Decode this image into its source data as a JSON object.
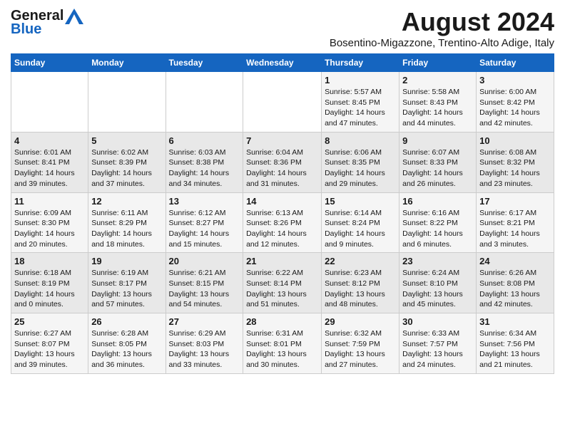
{
  "header": {
    "logo_general": "General",
    "logo_blue": "Blue",
    "month_year": "August 2024",
    "location": "Bosentino-Migazzone, Trentino-Alto Adige, Italy"
  },
  "days_of_week": [
    "Sunday",
    "Monday",
    "Tuesday",
    "Wednesday",
    "Thursday",
    "Friday",
    "Saturday"
  ],
  "weeks": [
    [
      {
        "day": "",
        "info": ""
      },
      {
        "day": "",
        "info": ""
      },
      {
        "day": "",
        "info": ""
      },
      {
        "day": "",
        "info": ""
      },
      {
        "day": "1",
        "info": "Sunrise: 5:57 AM\nSunset: 8:45 PM\nDaylight: 14 hours\nand 47 minutes."
      },
      {
        "day": "2",
        "info": "Sunrise: 5:58 AM\nSunset: 8:43 PM\nDaylight: 14 hours\nand 44 minutes."
      },
      {
        "day": "3",
        "info": "Sunrise: 6:00 AM\nSunset: 8:42 PM\nDaylight: 14 hours\nand 42 minutes."
      }
    ],
    [
      {
        "day": "4",
        "info": "Sunrise: 6:01 AM\nSunset: 8:41 PM\nDaylight: 14 hours\nand 39 minutes."
      },
      {
        "day": "5",
        "info": "Sunrise: 6:02 AM\nSunset: 8:39 PM\nDaylight: 14 hours\nand 37 minutes."
      },
      {
        "day": "6",
        "info": "Sunrise: 6:03 AM\nSunset: 8:38 PM\nDaylight: 14 hours\nand 34 minutes."
      },
      {
        "day": "7",
        "info": "Sunrise: 6:04 AM\nSunset: 8:36 PM\nDaylight: 14 hours\nand 31 minutes."
      },
      {
        "day": "8",
        "info": "Sunrise: 6:06 AM\nSunset: 8:35 PM\nDaylight: 14 hours\nand 29 minutes."
      },
      {
        "day": "9",
        "info": "Sunrise: 6:07 AM\nSunset: 8:33 PM\nDaylight: 14 hours\nand 26 minutes."
      },
      {
        "day": "10",
        "info": "Sunrise: 6:08 AM\nSunset: 8:32 PM\nDaylight: 14 hours\nand 23 minutes."
      }
    ],
    [
      {
        "day": "11",
        "info": "Sunrise: 6:09 AM\nSunset: 8:30 PM\nDaylight: 14 hours\nand 20 minutes."
      },
      {
        "day": "12",
        "info": "Sunrise: 6:11 AM\nSunset: 8:29 PM\nDaylight: 14 hours\nand 18 minutes."
      },
      {
        "day": "13",
        "info": "Sunrise: 6:12 AM\nSunset: 8:27 PM\nDaylight: 14 hours\nand 15 minutes."
      },
      {
        "day": "14",
        "info": "Sunrise: 6:13 AM\nSunset: 8:26 PM\nDaylight: 14 hours\nand 12 minutes."
      },
      {
        "day": "15",
        "info": "Sunrise: 6:14 AM\nSunset: 8:24 PM\nDaylight: 14 hours\nand 9 minutes."
      },
      {
        "day": "16",
        "info": "Sunrise: 6:16 AM\nSunset: 8:22 PM\nDaylight: 14 hours\nand 6 minutes."
      },
      {
        "day": "17",
        "info": "Sunrise: 6:17 AM\nSunset: 8:21 PM\nDaylight: 14 hours\nand 3 minutes."
      }
    ],
    [
      {
        "day": "18",
        "info": "Sunrise: 6:18 AM\nSunset: 8:19 PM\nDaylight: 14 hours\nand 0 minutes."
      },
      {
        "day": "19",
        "info": "Sunrise: 6:19 AM\nSunset: 8:17 PM\nDaylight: 13 hours\nand 57 minutes."
      },
      {
        "day": "20",
        "info": "Sunrise: 6:21 AM\nSunset: 8:15 PM\nDaylight: 13 hours\nand 54 minutes."
      },
      {
        "day": "21",
        "info": "Sunrise: 6:22 AM\nSunset: 8:14 PM\nDaylight: 13 hours\nand 51 minutes."
      },
      {
        "day": "22",
        "info": "Sunrise: 6:23 AM\nSunset: 8:12 PM\nDaylight: 13 hours\nand 48 minutes."
      },
      {
        "day": "23",
        "info": "Sunrise: 6:24 AM\nSunset: 8:10 PM\nDaylight: 13 hours\nand 45 minutes."
      },
      {
        "day": "24",
        "info": "Sunrise: 6:26 AM\nSunset: 8:08 PM\nDaylight: 13 hours\nand 42 minutes."
      }
    ],
    [
      {
        "day": "25",
        "info": "Sunrise: 6:27 AM\nSunset: 8:07 PM\nDaylight: 13 hours\nand 39 minutes."
      },
      {
        "day": "26",
        "info": "Sunrise: 6:28 AM\nSunset: 8:05 PM\nDaylight: 13 hours\nand 36 minutes."
      },
      {
        "day": "27",
        "info": "Sunrise: 6:29 AM\nSunset: 8:03 PM\nDaylight: 13 hours\nand 33 minutes."
      },
      {
        "day": "28",
        "info": "Sunrise: 6:31 AM\nSunset: 8:01 PM\nDaylight: 13 hours\nand 30 minutes."
      },
      {
        "day": "29",
        "info": "Sunrise: 6:32 AM\nSunset: 7:59 PM\nDaylight: 13 hours\nand 27 minutes."
      },
      {
        "day": "30",
        "info": "Sunrise: 6:33 AM\nSunset: 7:57 PM\nDaylight: 13 hours\nand 24 minutes."
      },
      {
        "day": "31",
        "info": "Sunrise: 6:34 AM\nSunset: 7:56 PM\nDaylight: 13 hours\nand 21 minutes."
      }
    ]
  ]
}
